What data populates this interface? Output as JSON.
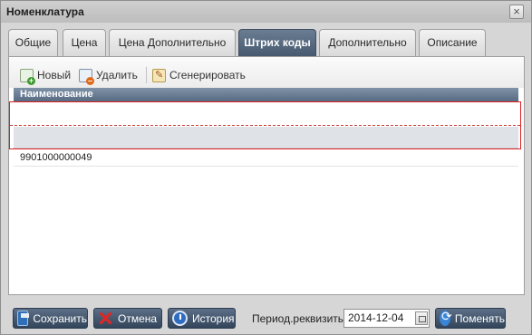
{
  "window": {
    "title": "Номенклатура",
    "close_glyph": "×"
  },
  "tabs": [
    {
      "label": "Общие",
      "active": false
    },
    {
      "label": "Цена",
      "active": false
    },
    {
      "label": "Цена Дополнительно",
      "active": false
    },
    {
      "label": "Штрих коды",
      "active": true
    },
    {
      "label": "Дополнительно",
      "active": false
    },
    {
      "label": "Описание",
      "active": false
    }
  ],
  "toolbar": {
    "new_label": "Новый",
    "delete_label": "Удалить",
    "generate_label": "Сгенерировать"
  },
  "grid": {
    "column_header": "Наименование",
    "rows": [
      "",
      "",
      "9901000000049"
    ]
  },
  "footer": {
    "save_label": "Сохранить",
    "cancel_label": "Отмена",
    "history_label": "История",
    "period_label": "Период.реквизиты:",
    "period_value": "2014-12-04",
    "change_label": "Поменять"
  },
  "colors": {
    "active_tab": "#46586e",
    "header": "#566a82",
    "highlight": "#e02020"
  }
}
